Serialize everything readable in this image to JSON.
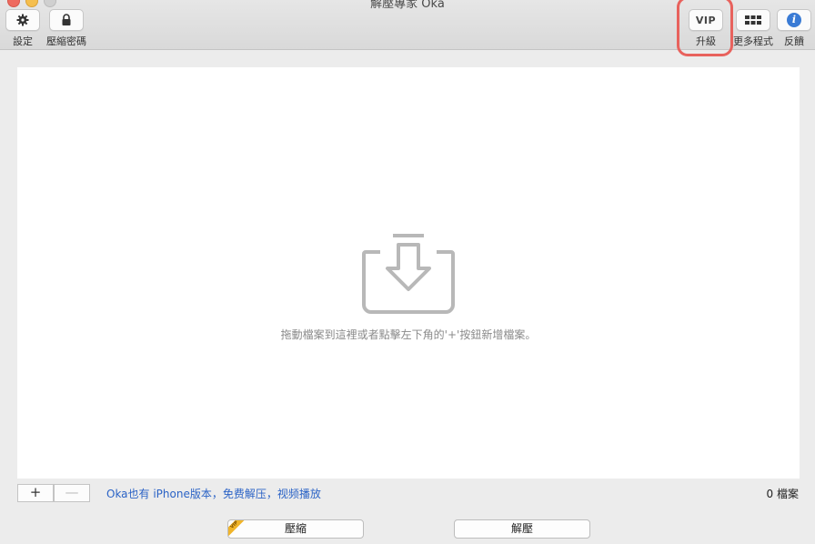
{
  "window": {
    "title": "解壓專家 Oka"
  },
  "toolbar": {
    "settings_label": "設定",
    "password_label": "壓縮密碼",
    "vip_button_text": "VIP",
    "upgrade_label": "升級",
    "more_apps_label": "更多程式",
    "feedback_label": "反饋",
    "settings_icon": "gear-icon",
    "password_icon": "lock-icon",
    "more_apps_icon": "grid-icon",
    "feedback_icon": "info-icon",
    "feedback_icon_glyph": "i"
  },
  "dropzone": {
    "hint": "拖動檔案到這裡或者點擊左下角的'+'按鈕新增檔案。",
    "icon": "tray-download-icon"
  },
  "bottom": {
    "add_label": "+",
    "remove_label": "—",
    "promo_text": "Oka也有 iPhone版本，免费解压，视频播放",
    "file_count": "0 檔案",
    "compress_label": "壓縮",
    "extract_label": "解壓",
    "vip_tag": "VIP"
  },
  "colors": {
    "highlight": "#e8625d",
    "link": "#2b63c6",
    "vip_tag": "#f0b429",
    "info": "#3a7bd5"
  }
}
